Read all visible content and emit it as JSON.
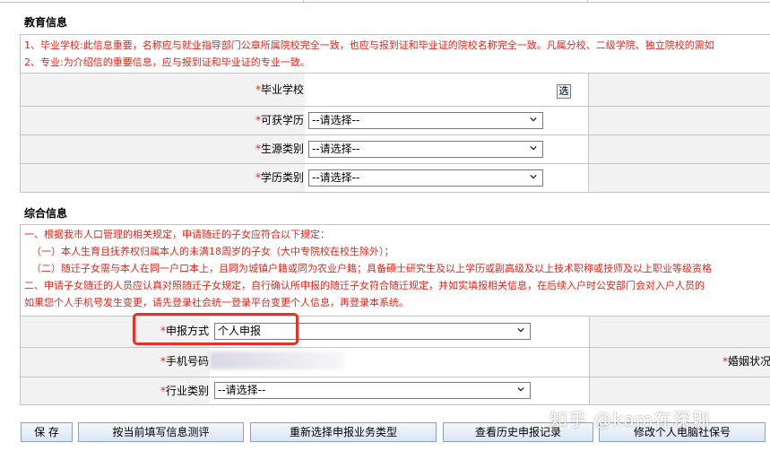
{
  "education": {
    "title": "教育信息",
    "notes": [
      "1、毕业学校:此信息重要，名称应与就业指导部门公章所属院校完全一致，也应与报到证和毕业证的院校名称完全一致。凡属分校、二级学院、独立院校的需如",
      "2、专业:为介绍信的重要信息，应与报到证和毕业证的专业一致。"
    ],
    "fields": {
      "school_label": "毕业学校",
      "school_pick": "选",
      "degree_label": "可获学历",
      "degree_value": "--请选择--",
      "source_label": "生源类别",
      "source_value": "--请选择--",
      "edutype_label": "学历类别",
      "edutype_value": "--请选择--"
    }
  },
  "general": {
    "title": "综合信息",
    "notes": [
      "一、根据我市人口管理的相关规定，申请随迁的子女应符合以下规定：",
      "（一）本人生育且抚养权归属本人的未满18周岁的子女（大中专院校在校生除外）；",
      "（二）随迁子女需与本人在同一户口本上，且同为城镇户籍或同为农业户籍；具备硕士研究生及以上学历或副高级及以上技术职称或技师及以上职业等级资格",
      "二、申请子女随迁的人员应认真对照随迁子女规定，自行确认所申报的随迁子女符合随迁规定，并如实填报相关信息，在后续入户时公安部门会对入户人员的",
      "如果您个人手机号发生变更，请先登录社会统一登录平台变更个人信息，再登录本系统。"
    ],
    "fields": {
      "apply_mode_label": "申报方式",
      "apply_mode_value": "个人申报",
      "phone_label": "手机号码",
      "marital_label": "婚姻状况",
      "industry_label": "行业类别",
      "industry_value": "--请选择--"
    }
  },
  "required_mark": "*",
  "buttons": {
    "save": "保 存",
    "test": "按当前填写信息测评",
    "reselect": "重新选择申报业务类型",
    "history": "查看历史申报记录",
    "modify": "修改个人电脑社保号"
  },
  "watermark": "知乎 @kam在深圳",
  "colors": {
    "required": "#e0261b",
    "notice_text": "#e0261b",
    "highlight": "#e53228",
    "row_bg": "#f2f2f2"
  },
  "icons": {
    "select_arrow": "chevron-down-icon"
  }
}
